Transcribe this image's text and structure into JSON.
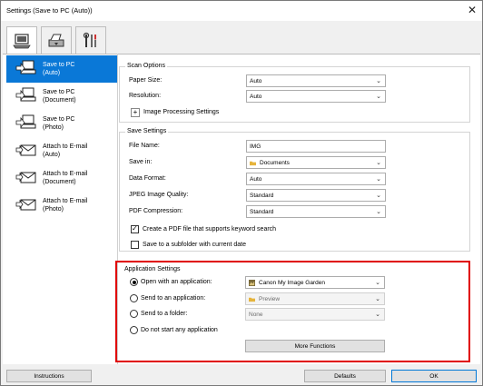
{
  "window": {
    "title": "Settings (Save to PC (Auto))",
    "close_glyph": "✕"
  },
  "tabs": [
    {
      "icon": "computer-icon"
    },
    {
      "icon": "scanner-icon"
    },
    {
      "icon": "tools-icon"
    }
  ],
  "sidebar": {
    "items": [
      {
        "label": "Save to PC\n(Auto)",
        "icon": "save-to-pc-icon",
        "selected": true
      },
      {
        "label": "Save to PC\n(Document)",
        "icon": "save-to-pc-icon"
      },
      {
        "label": "Save to PC\n(Photo)",
        "icon": "save-to-pc-icon"
      },
      {
        "label": "Attach to E-mail\n(Auto)",
        "icon": "email-icon"
      },
      {
        "label": "Attach to E-mail\n(Document)",
        "icon": "email-icon"
      },
      {
        "label": "Attach to E-mail\n(Photo)",
        "icon": "email-icon"
      }
    ]
  },
  "scan_options": {
    "title": "Scan Options",
    "paper_size_label": "Paper Size:",
    "paper_size_value": "Auto",
    "resolution_label": "Resolution:",
    "resolution_value": "Auto",
    "image_processing_label": "Image Processing Settings"
  },
  "save_settings": {
    "title": "Save Settings",
    "file_name_label": "File Name:",
    "file_name_value": "IMG",
    "save_in_label": "Save in:",
    "save_in_value": "Documents",
    "data_format_label": "Data Format:",
    "data_format_value": "Auto",
    "jpeg_quality_label": "JPEG Image Quality:",
    "jpeg_quality_value": "Standard",
    "pdf_compression_label": "PDF Compression:",
    "pdf_compression_value": "Standard",
    "keyword_search_label": "Create a PDF file that supports keyword search",
    "keyword_search_checked": true,
    "subfolder_label": "Save to a subfolder with current date",
    "subfolder_checked": false
  },
  "application_settings": {
    "title": "Application Settings",
    "open_with_label": "Open with an application:",
    "open_with_value": "Canon My Image Garden",
    "send_to_app_label": "Send to an application:",
    "send_to_app_value": "Preview",
    "send_to_folder_label": "Send to a folder:",
    "send_to_folder_value": "None",
    "do_not_start_label": "Do not start any application",
    "more_functions_label": "More Functions",
    "selected": "open_with"
  },
  "footer": {
    "instructions_label": "Instructions",
    "defaults_label": "Defaults",
    "ok_label": "OK"
  },
  "colors": {
    "selection": "#0a78d7",
    "highlight_box": "#e00000"
  }
}
